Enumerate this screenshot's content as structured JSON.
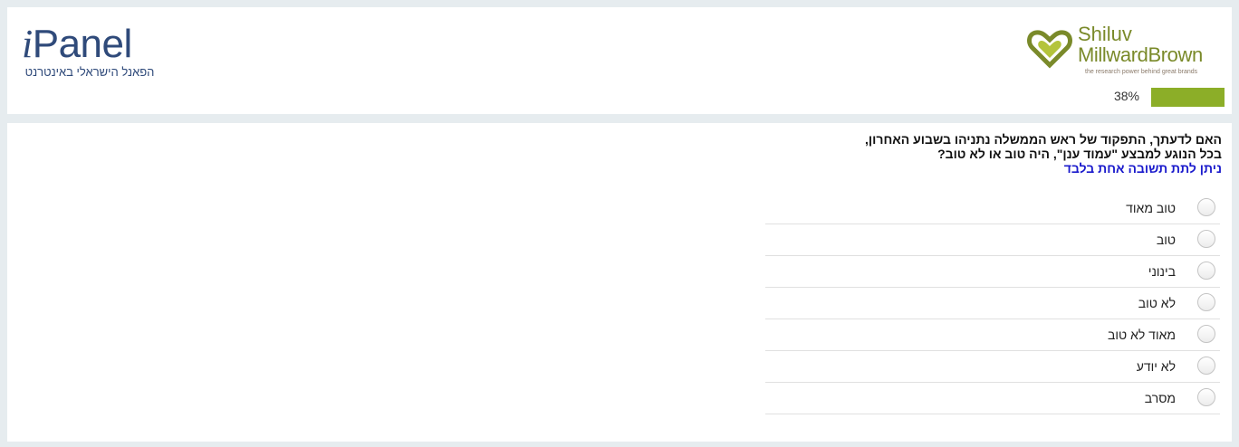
{
  "header": {
    "ipanel_logo": {
      "word": "Panel",
      "i": "i",
      "tagline": "הפאנל הישראלי באינטרנט"
    },
    "smb_logo": {
      "line1": "Shiluv",
      "line2": "MillwardBrown",
      "tagline": "the research power behind great brands"
    },
    "progress": {
      "label": "38%",
      "value": 0.38,
      "color": "#8cae28"
    }
  },
  "question": {
    "text": "האם לדעתך, התפקוד של ראש הממשלה נתניהו בשבוע האחרון, בכל הנוגע למבצע \"עמוד ענן\", היה טוב או לא טוב?",
    "instruction": "ניתן לתת תשובה אחת בלבד",
    "instruction_color": "#1a1acc",
    "options": [
      {
        "label": "טוב מאוד"
      },
      {
        "label": "טוב"
      },
      {
        "label": "בינוני"
      },
      {
        "label": "לא טוב"
      },
      {
        "label": "מאוד לא טוב"
      },
      {
        "label": "לא יודע"
      },
      {
        "label": "מסרב"
      }
    ]
  }
}
